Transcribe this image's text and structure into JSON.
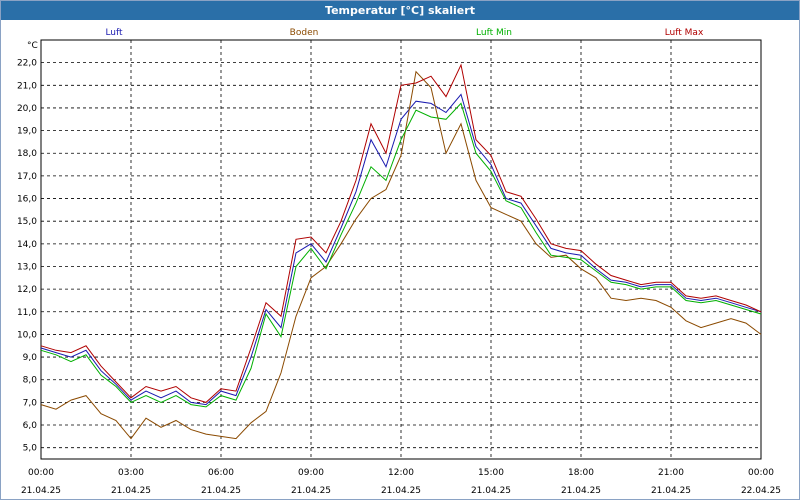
{
  "window": {
    "title": "Temperatur [°C] skaliert"
  },
  "colors": {
    "titlebar": "#2a6fa8",
    "luft": "#1a1ab0",
    "boden": "#8b4a00",
    "luft_min": "#00b000",
    "luft_max": "#b00000",
    "grid": "#000000"
  },
  "chart_data": {
    "type": "line",
    "title": "Temperatur [°C] skaliert",
    "ylabel": "°C",
    "xlabel": "",
    "ylim": [
      4.5,
      23
    ],
    "xlim": [
      0,
      24
    ],
    "grid": true,
    "legend_position": "top",
    "y_ticks": [
      "5,0",
      "6,0",
      "7,0",
      "8,0",
      "9,0",
      "10,0",
      "11,0",
      "12,0",
      "13,0",
      "14,0",
      "15,0",
      "16,0",
      "17,0",
      "18,0",
      "19,0",
      "20,0",
      "21,0",
      "22,0"
    ],
    "x_ticks": [
      {
        "time": "00:00",
        "date": "21.04.25"
      },
      {
        "time": "03:00",
        "date": "21.04.25"
      },
      {
        "time": "06:00",
        "date": "21.04.25"
      },
      {
        "time": "09:00",
        "date": "21.04.25"
      },
      {
        "time": "12:00",
        "date": "21.04.25"
      },
      {
        "time": "15:00",
        "date": "21.04.25"
      },
      {
        "time": "18:00",
        "date": "21.04.25"
      },
      {
        "time": "21:00",
        "date": "21.04.25"
      },
      {
        "time": "00:00",
        "date": "22.04.25"
      }
    ],
    "series": [
      {
        "name": "Luft",
        "color": "#1a1ab0",
        "x": [
          0,
          0.5,
          1,
          1.5,
          2,
          2.5,
          3,
          3.5,
          4,
          4.5,
          5,
          5.5,
          6,
          6.5,
          7,
          7.5,
          8,
          8.5,
          9,
          9.5,
          10,
          10.5,
          11,
          11.5,
          12,
          12.5,
          13,
          13.5,
          14,
          14.5,
          15,
          15.5,
          16,
          16.5,
          17,
          17.5,
          18,
          18.5,
          19,
          19.5,
          20,
          20.5,
          21,
          21.5,
          22,
          22.5,
          23,
          23.5,
          24
        ],
        "y": [
          9.4,
          9.2,
          9.0,
          9.3,
          8.4,
          7.8,
          7.1,
          7.5,
          7.2,
          7.5,
          7.0,
          6.9,
          7.5,
          7.3,
          9.0,
          11.1,
          10.3,
          13.6,
          14.0,
          13.2,
          14.7,
          16.3,
          18.6,
          17.4,
          19.5,
          20.3,
          20.2,
          19.8,
          20.6,
          18.3,
          17.5,
          16.0,
          15.8,
          14.8,
          13.8,
          13.6,
          13.5,
          12.9,
          12.4,
          12.3,
          12.1,
          12.2,
          12.2,
          11.6,
          11.5,
          11.6,
          11.4,
          11.2,
          11.0
        ]
      },
      {
        "name": "Boden",
        "color": "#8b4a00",
        "x": [
          0,
          0.5,
          1,
          1.5,
          2,
          2.5,
          3,
          3.5,
          4,
          4.5,
          5,
          5.5,
          6,
          6.5,
          7,
          7.5,
          8,
          8.5,
          9,
          9.5,
          10,
          10.5,
          11,
          11.5,
          12,
          12.5,
          13,
          13.5,
          14,
          14.5,
          15,
          15.5,
          16,
          16.5,
          17,
          17.5,
          18,
          18.5,
          19,
          19.5,
          20,
          20.5,
          21,
          21.5,
          22,
          22.5,
          23,
          23.5,
          24
        ],
        "y": [
          6.9,
          6.7,
          7.1,
          7.3,
          6.5,
          6.2,
          5.4,
          6.3,
          5.9,
          6.2,
          5.8,
          5.6,
          5.5,
          5.4,
          6.1,
          6.6,
          8.3,
          10.8,
          12.5,
          13.0,
          14.0,
          15.1,
          16.0,
          16.4,
          17.9,
          21.6,
          20.9,
          18.0,
          19.3,
          16.8,
          15.6,
          15.3,
          15.0,
          14.0,
          13.4,
          13.5,
          12.9,
          12.5,
          11.6,
          11.5,
          11.6,
          11.5,
          11.2,
          10.6,
          10.3,
          10.5,
          10.7,
          10.5,
          10.0
        ]
      },
      {
        "name": "Luft Min",
        "color": "#00b000",
        "x": [
          0,
          0.5,
          1,
          1.5,
          2,
          2.5,
          3,
          3.5,
          4,
          4.5,
          5,
          5.5,
          6,
          6.5,
          7,
          7.5,
          8,
          8.5,
          9,
          9.5,
          10,
          10.5,
          11,
          11.5,
          12,
          12.5,
          13,
          13.5,
          14,
          14.5,
          15,
          15.5,
          16,
          16.5,
          17,
          17.5,
          18,
          18.5,
          19,
          19.5,
          20,
          20.5,
          21,
          21.5,
          22,
          22.5,
          23,
          23.5,
          24
        ],
        "y": [
          9.3,
          9.1,
          8.8,
          9.1,
          8.2,
          7.7,
          7.0,
          7.3,
          7.0,
          7.3,
          6.9,
          6.8,
          7.3,
          7.1,
          8.5,
          10.9,
          9.9,
          13.0,
          13.8,
          12.9,
          14.4,
          15.8,
          17.4,
          16.8,
          18.6,
          19.9,
          19.6,
          19.5,
          20.2,
          18.0,
          17.2,
          15.9,
          15.6,
          14.5,
          13.5,
          13.4,
          13.3,
          12.8,
          12.3,
          12.2,
          12.0,
          12.1,
          12.1,
          11.5,
          11.4,
          11.5,
          11.3,
          11.1,
          10.9
        ]
      },
      {
        "name": "Luft Max",
        "color": "#b00000",
        "x": [
          0,
          0.5,
          1,
          1.5,
          2,
          2.5,
          3,
          3.5,
          4,
          4.5,
          5,
          5.5,
          6,
          6.5,
          7,
          7.5,
          8,
          8.5,
          9,
          9.5,
          10,
          10.5,
          11,
          11.5,
          12,
          12.5,
          13,
          13.5,
          14,
          14.5,
          15,
          15.5,
          16,
          16.5,
          17,
          17.5,
          18,
          18.5,
          19,
          19.5,
          20,
          20.5,
          21,
          21.5,
          22,
          22.5,
          23,
          23.5,
          24
        ],
        "y": [
          9.5,
          9.3,
          9.2,
          9.5,
          8.6,
          7.9,
          7.2,
          7.7,
          7.5,
          7.7,
          7.2,
          7.0,
          7.6,
          7.5,
          9.4,
          11.4,
          10.8,
          14.2,
          14.3,
          13.6,
          15.0,
          16.8,
          19.3,
          18.0,
          21.0,
          21.1,
          21.4,
          20.5,
          21.9,
          18.6,
          17.9,
          16.3,
          16.1,
          15.1,
          14.0,
          13.8,
          13.7,
          13.1,
          12.6,
          12.4,
          12.2,
          12.3,
          12.3,
          11.7,
          11.6,
          11.7,
          11.5,
          11.3,
          11.0
        ]
      }
    ]
  }
}
